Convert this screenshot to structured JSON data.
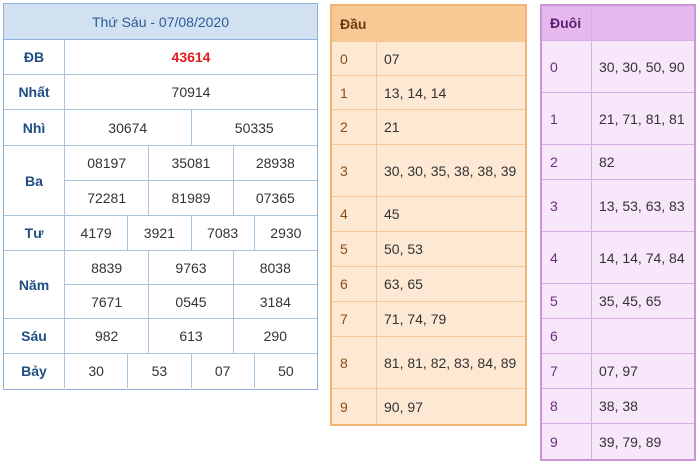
{
  "results": {
    "title": "Thứ Sáu - 07/08/2020",
    "rows": [
      {
        "label": "ĐB",
        "lines": [
          [
            "43614"
          ]
        ],
        "special": true
      },
      {
        "label": "Nhất",
        "lines": [
          [
            "70914"
          ]
        ]
      },
      {
        "label": "Nhì",
        "lines": [
          [
            "30674",
            "50335"
          ]
        ]
      },
      {
        "label": "Ba",
        "lines": [
          [
            "08197",
            "35081",
            "28938"
          ],
          [
            "72281",
            "81989",
            "07365"
          ]
        ]
      },
      {
        "label": "Tư",
        "lines": [
          [
            "4179",
            "3921",
            "7083",
            "2930"
          ]
        ]
      },
      {
        "label": "Năm",
        "lines": [
          [
            "8839",
            "9763",
            "8038"
          ],
          [
            "7671",
            "0545",
            "3184"
          ]
        ]
      },
      {
        "label": "Sáu",
        "lines": [
          [
            "982",
            "613",
            "290"
          ]
        ]
      },
      {
        "label": "Bảy",
        "lines": [
          [
            "30",
            "53",
            "07",
            "50"
          ]
        ]
      }
    ]
  },
  "dau": {
    "title": "Đầu",
    "rows": [
      {
        "key": "0",
        "value": "07"
      },
      {
        "key": "1",
        "value": "13, 14, 14"
      },
      {
        "key": "2",
        "value": "21"
      },
      {
        "key": "3",
        "value": "30, 30, 35, 38, 38, 39"
      },
      {
        "key": "4",
        "value": "45"
      },
      {
        "key": "5",
        "value": "50, 53"
      },
      {
        "key": "6",
        "value": "63, 65"
      },
      {
        "key": "7",
        "value": "71, 74, 79"
      },
      {
        "key": "8",
        "value": "81, 81, 82, 83, 84, 89"
      },
      {
        "key": "9",
        "value": "90, 97"
      }
    ]
  },
  "duoi": {
    "title": "Đuôi",
    "rows": [
      {
        "key": "0",
        "value": "30, 30, 50, 90"
      },
      {
        "key": "1",
        "value": "21, 71, 81, 81"
      },
      {
        "key": "2",
        "value": "82"
      },
      {
        "key": "3",
        "value": "13, 53, 63, 83"
      },
      {
        "key": "4",
        "value": "14, 14, 74, 84"
      },
      {
        "key": "5",
        "value": "35, 45, 65"
      },
      {
        "key": "6",
        "value": ""
      },
      {
        "key": "7",
        "value": "07, 97"
      },
      {
        "key": "8",
        "value": "38, 38"
      },
      {
        "key": "9",
        "value": "39, 79, 89"
      }
    ]
  },
  "colors": {
    "special_prize": "#e41b1b",
    "results_header": "#d2e1f2",
    "dau_header": "#f7c995",
    "dau_body": "#fde8d3",
    "duoi_header": "#e5b9ee",
    "duoi_body": "#f8e6fb"
  }
}
